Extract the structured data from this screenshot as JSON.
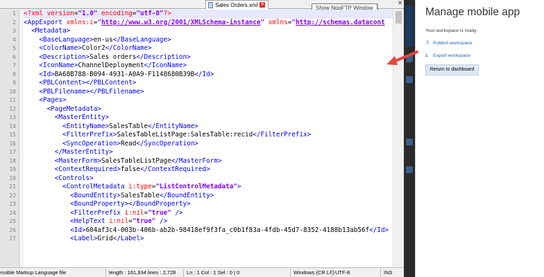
{
  "editor": {
    "tab_label": "Sales Orders.xml",
    "tooltip": "Show NppFTP Window",
    "window_close": "✕",
    "line_numbers": [
      "1",
      "2",
      "3",
      "4",
      "5",
      "6",
      "7",
      "8",
      "9",
      "10",
      "11",
      "12",
      "13",
      "14",
      "15",
      "16",
      "17",
      "18",
      "19",
      "20",
      "21",
      "22",
      "23",
      "24",
      "25",
      "26",
      "27"
    ]
  },
  "statusbar": {
    "file_type": "eXtensible Markup Language file",
    "length_lines": "length : 161,934    lines : 2,728",
    "position": "Ln : 1    Col : 1    Sel : 0 | 0",
    "eol": "Windows (CR LF)",
    "encoding": "UTF-8",
    "mode": "INS"
  },
  "pane": {
    "title": "Manage mobile app",
    "status": "Your workspace is ready",
    "publish_label": "Publish workspace",
    "export_label": "Export workspace",
    "return_label": "Return to dashboard"
  },
  "colors": {
    "tag": "#0000ff",
    "attribute": "#ff0000",
    "value": "#8000ff",
    "link": "#1f5fa8",
    "arrow": "#e8463c"
  }
}
